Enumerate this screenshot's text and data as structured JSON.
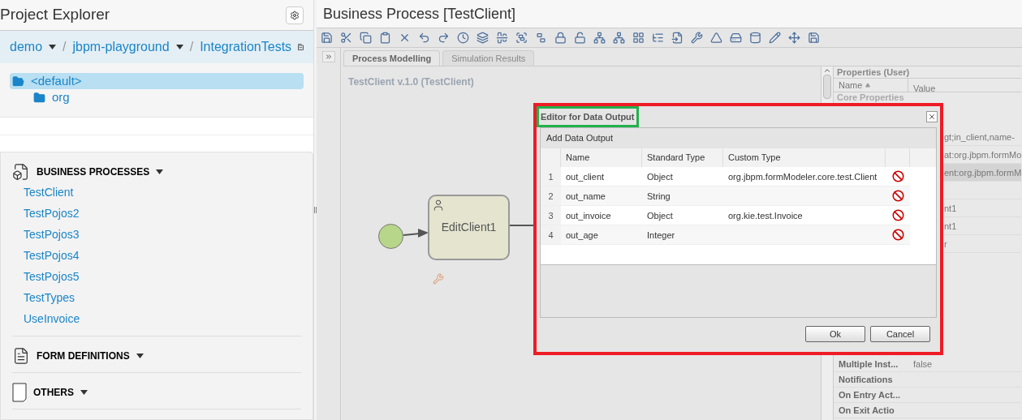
{
  "explorer": {
    "title": "Project Explorer",
    "breadcrumb": [
      {
        "label": "demo",
        "dropdown": true
      },
      {
        "separator": "/",
        "label": "jbpm-playground",
        "dropdown": true
      },
      {
        "separator": "/",
        "label": "IntegrationTests",
        "dropdown": false
      }
    ],
    "packages": [
      {
        "label": "<default>",
        "selected": true,
        "expanded": true,
        "children": [
          {
            "label": "org",
            "selected": false,
            "expanded": false
          }
        ]
      }
    ],
    "sections": [
      {
        "title": "BUSINESS PROCESSES",
        "kind": "process",
        "items": [
          "TestClient",
          "TestPojos2",
          "TestPojos3",
          "TestPojos4",
          "TestPojos5",
          "TestTypes",
          "UseInvoice"
        ]
      },
      {
        "title": "FORM DEFINITIONS",
        "kind": "form"
      },
      {
        "title": "OTHERS",
        "kind": "other"
      }
    ]
  },
  "editor": {
    "title": "Business Process [TestClient]",
    "tabs": [
      {
        "label": "Process Modelling",
        "selected": true
      },
      {
        "label": "Simulation Results",
        "selected": false
      }
    ],
    "canvas_title": "TestClient v.1.0 (TestClient)",
    "task_label": "EditClient1"
  },
  "properties": {
    "title": "Properties (User)",
    "columns": [
      "Name",
      "Value"
    ],
    "group": "Core Properties",
    "rows": [
      {
        "name": "",
        "value": "gt;in_client,name-",
        "selected": false
      },
      {
        "name": "",
        "value": "at:org.jbpm.formMo",
        "selected": false
      },
      {
        "name": "",
        "value": "ent:org.jbpm.formM",
        "selected": true
      },
      {
        "name": "",
        "value": "",
        "selected": false
      },
      {
        "name": "",
        "value": "nt1",
        "selected": false
      },
      {
        "name": "",
        "value": "nt1",
        "selected": false
      },
      {
        "name": "",
        "value": "r",
        "selected": false
      }
    ],
    "bottom_rows": [
      {
        "name": "Multiple Inst...",
        "value": "false"
      },
      {
        "name": "Notifications",
        "value": ""
      },
      {
        "name": "On Entry Act...",
        "value": ""
      },
      {
        "name": "On Exit Actio",
        "value": ""
      }
    ]
  },
  "dialog": {
    "title": "Editor for Data Output",
    "subtitle": "Add Data Output",
    "columns": [
      "Name",
      "Standard Type",
      "Custom Type"
    ],
    "rows": [
      {
        "num": "1",
        "name": "out_client",
        "standard": "Object",
        "custom": "org.jbpm.formModeler.core.test.Client"
      },
      {
        "num": "2",
        "name": "out_name",
        "standard": "String",
        "custom": ""
      },
      {
        "num": "3",
        "name": "out_invoice",
        "standard": "Object",
        "custom": "org.kie.test.Invoice"
      },
      {
        "num": "4",
        "name": "out_age",
        "standard": "Integer",
        "custom": ""
      }
    ],
    "buttons": [
      "Ok",
      "Cancel"
    ]
  }
}
